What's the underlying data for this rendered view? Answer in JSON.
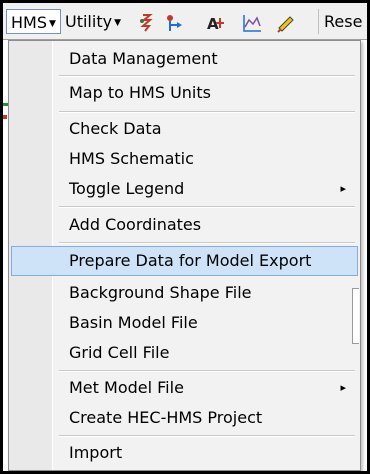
{
  "toolbar": {
    "hms_label": "HMS",
    "utility_label": "Utility",
    "res_label": "Rese",
    "icons": [
      "hydrograph-tool-icon",
      "flow-path-icon",
      "attribute-tool-icon",
      "profile-graph-icon",
      "edit-pencil-icon"
    ]
  },
  "menu": {
    "items": [
      {
        "label": "Data Management"
      },
      {
        "label": "Map to HMS Units"
      },
      {
        "label": "Check Data"
      },
      {
        "label": "HMS Schematic"
      },
      {
        "label": "Toggle Legend",
        "submenu": "▸"
      },
      {
        "label": "Add Coordinates"
      },
      {
        "label": "Prepare Data for Model Export"
      },
      {
        "label": "Background Shape File"
      },
      {
        "label": "Basin Model File"
      },
      {
        "label": "Grid Cell File"
      },
      {
        "label": "Met Model File",
        "submenu": "▸"
      },
      {
        "label": "Create HEC-HMS Project"
      },
      {
        "label": "Import"
      }
    ],
    "highlighted": "Prepare Data for Model Export"
  },
  "colors": {
    "highlight": "#cfe3f8",
    "highlight_border": "#84acdd",
    "menu_bg": "#f2f2f2"
  }
}
